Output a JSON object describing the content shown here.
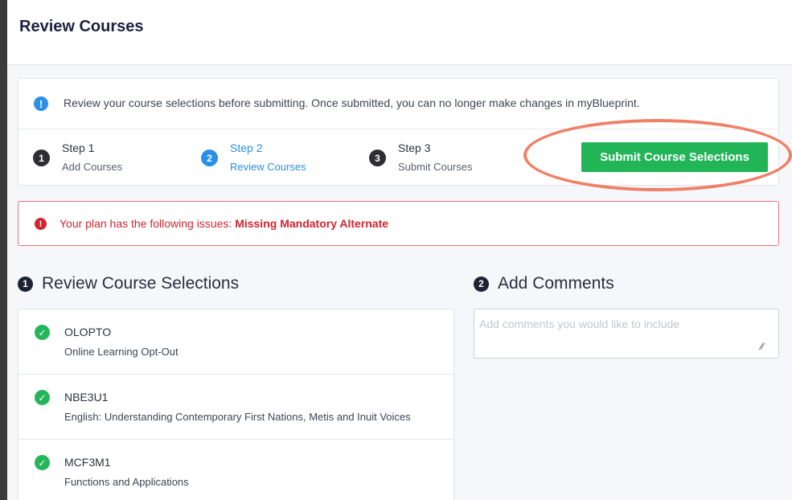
{
  "page": {
    "title": "Review Courses"
  },
  "notice": {
    "text": "Review your course selections before submitting. Once submitted, you can no longer make changes in myBlueprint."
  },
  "steps": [
    {
      "number": "1",
      "label": "Step 1",
      "sublabel": "Add Courses"
    },
    {
      "number": "2",
      "label": "Step 2",
      "sublabel": "Review Courses"
    },
    {
      "number": "3",
      "label": "Step 3",
      "sublabel": "Submit Courses"
    }
  ],
  "submit_button": {
    "label": "Submit Course Selections"
  },
  "alert": {
    "prefix": "Your plan has the following issues: ",
    "issue": "Missing Mandatory Alternate"
  },
  "review_section": {
    "number": "1",
    "title": "Review Course Selections"
  },
  "comments_section": {
    "number": "2",
    "title": "Add Comments",
    "placeholder": "Add comments you would like to include"
  },
  "courses": [
    {
      "code": "OLOPTO",
      "name": "Online Learning Opt-Out"
    },
    {
      "code": "NBE3U1",
      "name": "English: Understanding Contemporary First Nations, Metis and Inuit Voices"
    },
    {
      "code": "MCF3M1",
      "name": "Functions and Applications"
    }
  ],
  "colors": {
    "primary": "#2a8fe6",
    "success": "#21b558",
    "danger": "#d0252f",
    "highlight": "#ef8066"
  },
  "icons": {
    "info": "info-circle-icon",
    "alert": "exclamation-circle-icon",
    "check": "check-circle-icon"
  }
}
